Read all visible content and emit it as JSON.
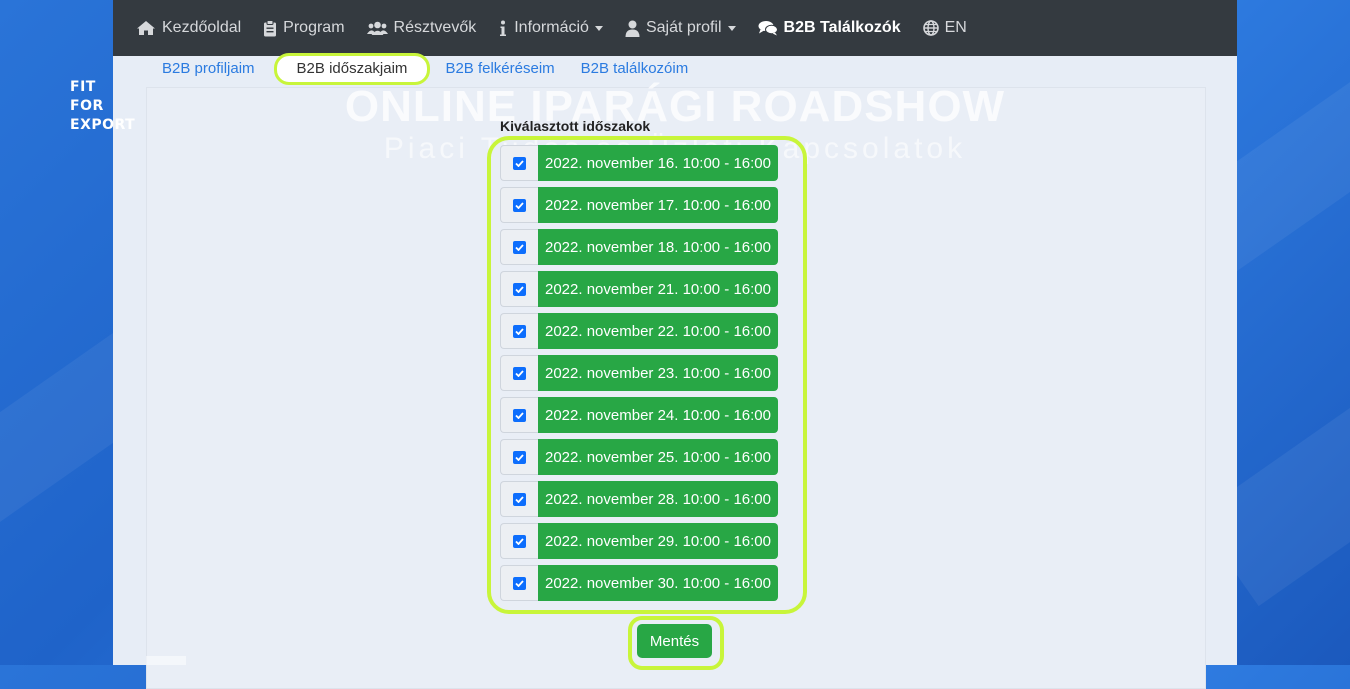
{
  "logo": {
    "line1": "FIT",
    "line2": "FOR",
    "line3": "EXPORT"
  },
  "nav": {
    "home": "Kezdőoldal",
    "program": "Program",
    "participants": "Résztvevők",
    "info": "Információ",
    "profile": "Saját profil",
    "b2b": "B2B Találkozók",
    "lang": "EN"
  },
  "tabs": {
    "profiles": "B2B profiljaim",
    "periods": "B2B időszakjaim",
    "requests": "B2B felkéréseim",
    "meetings": "B2B találkozóim"
  },
  "banner": {
    "title": "ONLINE IPARÁGI ROADSHOW",
    "subtitle": "Piaci Tudás és Üzleti Kapcsolatok"
  },
  "periods": {
    "heading": "Kiválasztott időszakok",
    "slots": [
      {
        "label": "2022. november 16. 10:00 - 16:00",
        "checked": true
      },
      {
        "label": "2022. november 17. 10:00 - 16:00",
        "checked": true
      },
      {
        "label": "2022. november 18. 10:00 - 16:00",
        "checked": true
      },
      {
        "label": "2022. november 21. 10:00 - 16:00",
        "checked": true
      },
      {
        "label": "2022. november 22. 10:00 - 16:00",
        "checked": true
      },
      {
        "label": "2022. november 23. 10:00 - 16:00",
        "checked": true
      },
      {
        "label": "2022. november 24. 10:00 - 16:00",
        "checked": true
      },
      {
        "label": "2022. november 25. 10:00 - 16:00",
        "checked": true
      },
      {
        "label": "2022. november 28. 10:00 - 16:00",
        "checked": true
      },
      {
        "label": "2022. november 29. 10:00 - 16:00",
        "checked": true
      },
      {
        "label": "2022. november 30. 10:00 - 16:00",
        "checked": true
      }
    ],
    "save_label": "Mentés"
  },
  "colors": {
    "navbar": "#343a40",
    "success": "#28a745",
    "highlight": "#c8f53a",
    "link": "#2b7be0",
    "checkbox": "#0d6efd"
  }
}
